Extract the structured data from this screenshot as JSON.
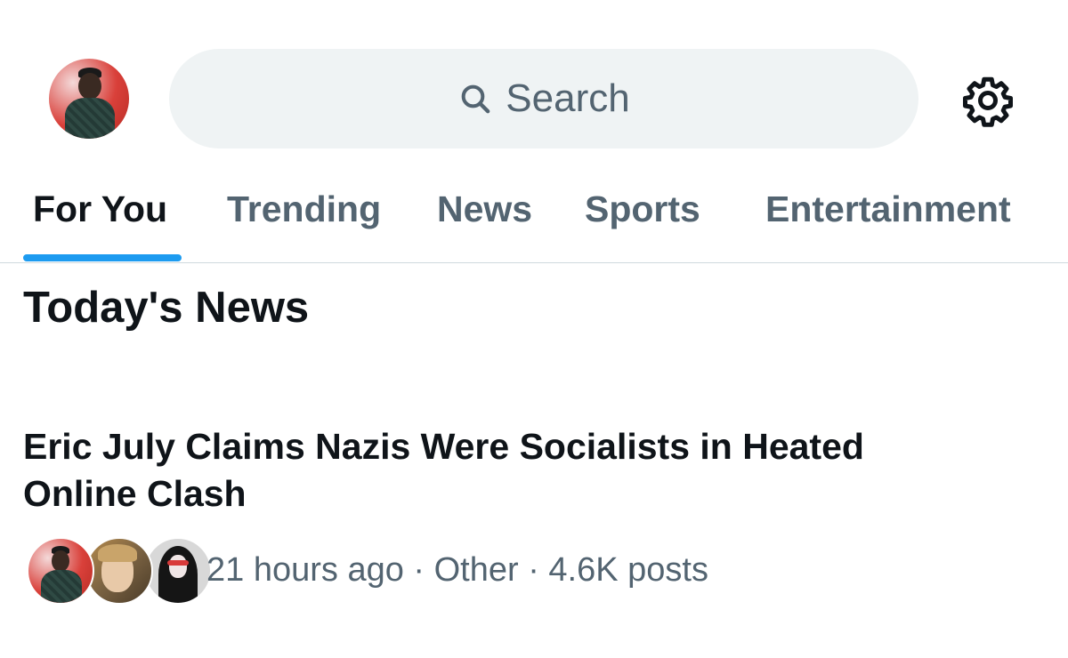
{
  "header": {
    "avatar_icon": "profile-photo",
    "search": {
      "placeholder": "Search",
      "icon": "search-icon"
    },
    "settings_icon": "gear-icon"
  },
  "tabs": [
    {
      "label": "For You",
      "active": true
    },
    {
      "label": "Trending",
      "active": false
    },
    {
      "label": "News",
      "active": false
    },
    {
      "label": "Sports",
      "active": false
    },
    {
      "label": "Entertainment",
      "active": false
    }
  ],
  "section": {
    "title": "Today's News"
  },
  "news_item": {
    "headline": "Eric July Claims Nazis Were Socialists in Heated Online Clash",
    "meta": "21 hours ago · Other · 4.6K posts"
  },
  "colors": {
    "accent": "#1d9bf0",
    "text_primary": "#0f1419",
    "text_secondary": "#536471",
    "search_bg": "#eff3f4",
    "divider": "#cfd9de"
  }
}
